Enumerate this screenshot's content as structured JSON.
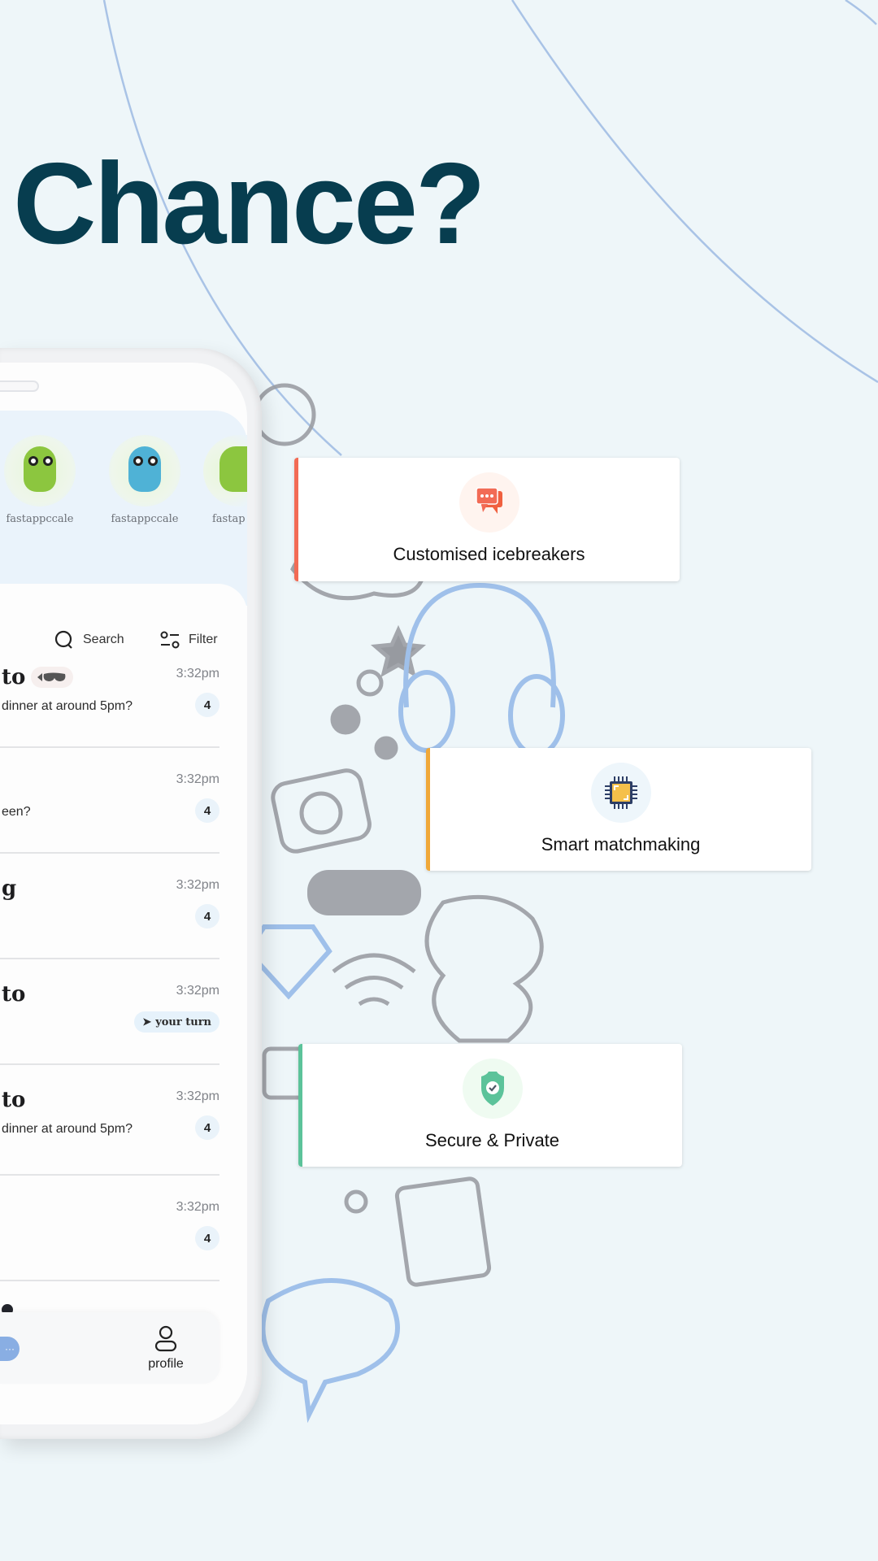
{
  "headline": "Chance?",
  "app": {
    "stories": [
      {
        "label": "fastappccale",
        "avatar": "green-monster"
      },
      {
        "label": "fastappccale",
        "avatar": "blue-angel-monster"
      },
      {
        "label": "fastap",
        "avatar": "green-monster"
      }
    ],
    "toolbar": {
      "search_label": "Search",
      "filter_label": "Filter"
    },
    "chats": [
      {
        "name": "to",
        "has_mask": true,
        "time": "3:32pm",
        "message": "dinner at around 5pm?",
        "badge": "4"
      },
      {
        "name": "",
        "time": "3:32pm",
        "message": "een?",
        "badge": "4"
      },
      {
        "name": "g",
        "time": "3:32pm",
        "message": "",
        "badge": "4"
      },
      {
        "name": "to",
        "time": "3:32pm",
        "message": "",
        "turn": "your turn"
      },
      {
        "name": "to",
        "time": "3:32pm",
        "message": "dinner at around 5pm?",
        "badge": "4"
      },
      {
        "name": "",
        "time": "3:32pm",
        "message": "",
        "badge": "4"
      }
    ],
    "nav": {
      "chat_icon": "···",
      "profile_label": "profile"
    }
  },
  "features": [
    {
      "label": "Customised icebreakers",
      "icon": "chat-bubbles-icon",
      "accent": "#f26b55"
    },
    {
      "label": "Smart matchmaking",
      "icon": "chip-icon",
      "accent": "#f0a838"
    },
    {
      "label": "Secure & Private",
      "icon": "shield-check-icon",
      "accent": "#5cc39a"
    }
  ],
  "colors": {
    "headline": "#073d4f",
    "background": "#eef6f9"
  }
}
